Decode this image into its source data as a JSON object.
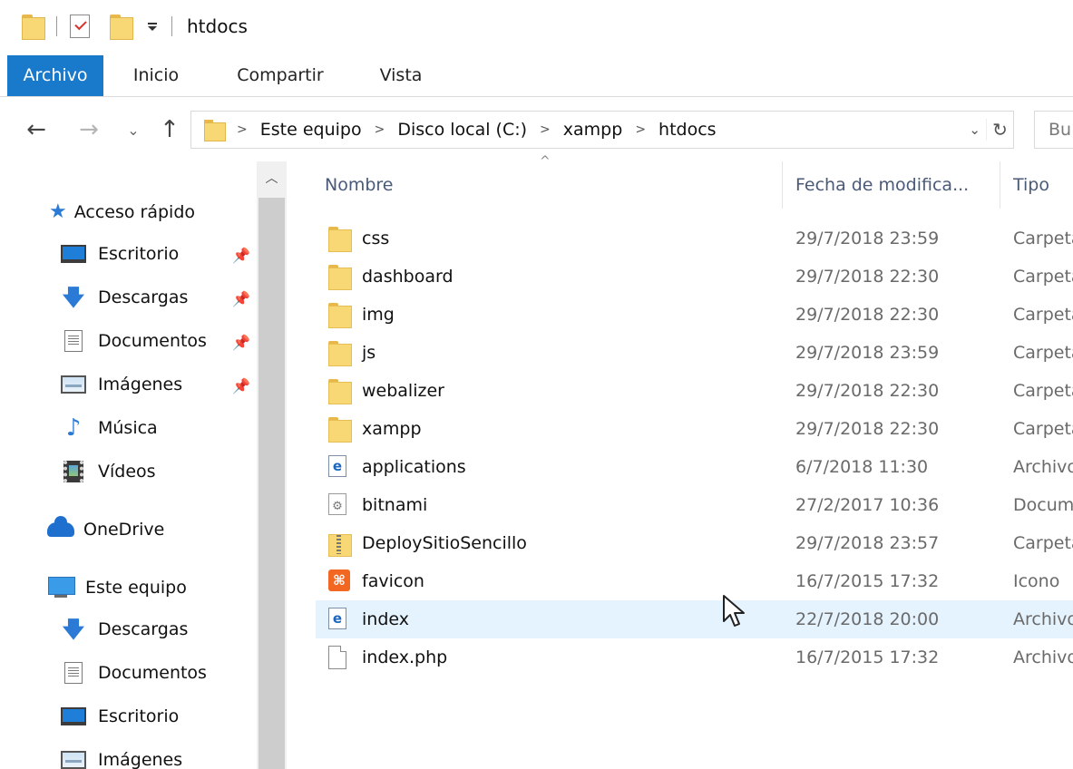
{
  "window": {
    "title": "htdocs"
  },
  "quick_access_toolbar": {
    "icons": [
      "folder-icon",
      "properties-icon",
      "new-folder-icon",
      "customize-dropdown-icon"
    ]
  },
  "ribbon": {
    "tabs": [
      {
        "label": "Archivo",
        "active": true
      },
      {
        "label": "Inicio",
        "active": false
      },
      {
        "label": "Compartir",
        "active": false
      },
      {
        "label": "Vista",
        "active": false
      }
    ],
    "accent_color": "#1979ca"
  },
  "navigation": {
    "back": "←",
    "forward": "→",
    "recent": "⌄",
    "up": "↑"
  },
  "address_bar": {
    "breadcrumbs": [
      "Este equipo",
      "Disco local (C:)",
      "xampp",
      "htdocs"
    ],
    "dropdown": "⌄",
    "refresh": "↻"
  },
  "search": {
    "placeholder": "Bu"
  },
  "nav_pane": {
    "quick_access_label": "Acceso rápido",
    "items": [
      {
        "label": "Escritorio",
        "icon": "desktop-icon",
        "pinned": true
      },
      {
        "label": "Descargas",
        "icon": "downloads-icon",
        "pinned": true
      },
      {
        "label": "Documentos",
        "icon": "documents-icon",
        "pinned": true
      },
      {
        "label": "Imágenes",
        "icon": "pictures-icon",
        "pinned": true
      },
      {
        "label": "Música",
        "icon": "music-icon",
        "pinned": false
      },
      {
        "label": "Vídeos",
        "icon": "videos-icon",
        "pinned": false
      }
    ],
    "onedrive_label": "OneDrive",
    "this_pc_label": "Este equipo",
    "this_pc_items": [
      {
        "label": "Descargas",
        "icon": "downloads-icon"
      },
      {
        "label": "Documentos",
        "icon": "documents-icon"
      },
      {
        "label": "Escritorio",
        "icon": "desktop-icon"
      },
      {
        "label": "Imágenes",
        "icon": "pictures-icon"
      }
    ]
  },
  "file_list": {
    "columns": [
      "Nombre",
      "Fecha de modifica...",
      "Tipo"
    ],
    "sort_indicator": "^",
    "rows": [
      {
        "name": "css",
        "date": "29/7/2018 23:59",
        "type": "Carpeta",
        "icon": "folder-icon"
      },
      {
        "name": "dashboard",
        "date": "29/7/2018 22:30",
        "type": "Carpeta",
        "icon": "folder-icon"
      },
      {
        "name": "img",
        "date": "29/7/2018 22:30",
        "type": "Carpeta",
        "icon": "folder-icon"
      },
      {
        "name": "js",
        "date": "29/7/2018 23:59",
        "type": "Carpeta",
        "icon": "folder-icon"
      },
      {
        "name": "webalizer",
        "date": "29/7/2018 22:30",
        "type": "Carpeta",
        "icon": "folder-icon"
      },
      {
        "name": "xampp",
        "date": "29/7/2018 22:30",
        "type": "Carpeta",
        "icon": "folder-icon"
      },
      {
        "name": "applications",
        "date": "6/7/2018 11:30",
        "type": "Archivo",
        "icon": "ie-html-icon"
      },
      {
        "name": "bitnami",
        "date": "27/2/2017 10:36",
        "type": "Documento",
        "icon": "settings-file-icon"
      },
      {
        "name": "DeploySitioSencillo",
        "date": "29/7/2018 23:57",
        "type": "Carpeta",
        "icon": "zip-folder-icon"
      },
      {
        "name": "favicon",
        "date": "16/7/2015 17:32",
        "type": "Icono",
        "icon": "xampp-icon"
      },
      {
        "name": "index",
        "date": "22/7/2018 20:00",
        "type": "Archivo",
        "icon": "ie-html-icon",
        "hovered": true
      },
      {
        "name": "index.php",
        "date": "16/7/2015 17:32",
        "type": "Archivo",
        "icon": "blank-file-icon"
      }
    ]
  }
}
